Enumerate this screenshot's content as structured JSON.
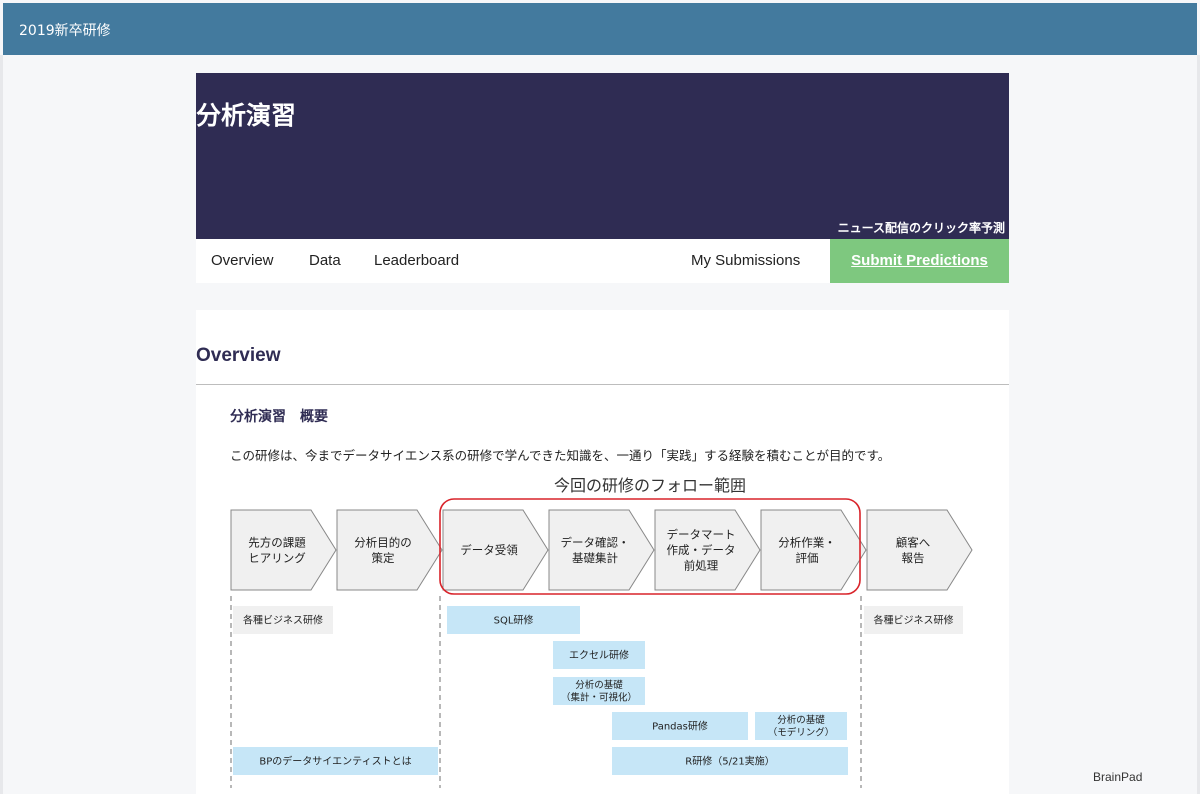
{
  "app": {
    "title": "2019新卒研修"
  },
  "hero": {
    "title": "分析演習",
    "subtitle": "ニュース配信のクリック率予測"
  },
  "tabs": {
    "overview": "Overview",
    "data": "Data",
    "leaderboard": "Leaderboard",
    "my_submissions": "My Submissions",
    "submit": "Submit Predictions"
  },
  "content": {
    "heading": "Overview",
    "subheading": "分析演習　概要",
    "paragraph": "この研修は、今までデータサイエンス系の研修で学んできた知識を、一通り「実践」する経験を積むことが目的です。"
  },
  "diagram": {
    "title": "今回の研修のフォロー範囲",
    "steps": [
      [
        "先方の課題",
        "ヒアリング"
      ],
      [
        "分析目的の",
        "策定"
      ],
      [
        "データ受領"
      ],
      [
        "データ確認・",
        "基礎集計"
      ],
      [
        "データマート",
        "作成・データ",
        "前処理"
      ],
      [
        "分析作業・",
        "評価"
      ],
      [
        "顧客へ",
        "報告"
      ]
    ],
    "gray_boxes": [
      "各種ビジネス研修",
      "各種ビジネス研修"
    ],
    "blue_boxes": [
      [
        "SQL研修"
      ],
      [
        "エクセル研修"
      ],
      [
        "分析の基礎",
        "（集計・可視化）"
      ],
      [
        "Pandas研修"
      ],
      [
        "分析の基礎",
        "（モデリング）"
      ],
      [
        "BPのデータサイエンティストとは"
      ],
      [
        "R研修（5/21実施）"
      ]
    ],
    "colors": {
      "step_fill": "#f0f0f0",
      "step_stroke": "#888888",
      "highlight": "#d9232a",
      "blue_box": "#c6e6f7",
      "gray_box": "#f0f0f0"
    }
  },
  "footer": {
    "brand": "BrainPad"
  }
}
